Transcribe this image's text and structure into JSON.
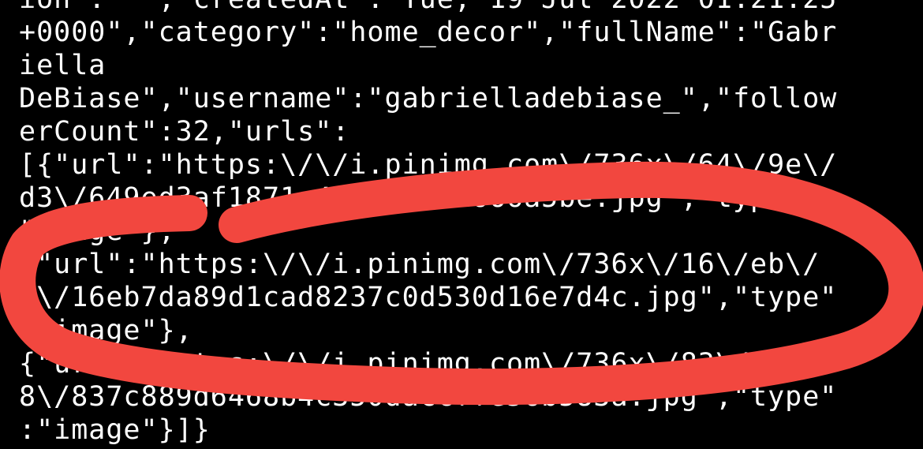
{
  "terminal": {
    "lines": [
      "ion\":\" \",\"createdAt\":\"Tue, 19 Jul 2022 01:21:25",
      "+0000\",\"category\":\"home_decor\",\"fullName\":\"Gabr",
      "iella",
      "DeBiase\",\"username\":\"gabrielladebiase_\",\"follow",
      "erCount\":32,\"urls\":",
      "[{\"url\":\"https:\\/\\/i.pinimg.com\\/736x\\/64\\/9e\\/",
      "d3\\/649ed3af1871c4d746...1666a5be.jpg\",\"type",
      "\"image\"},",
      "{\"url\":\"https:\\/\\/i.pinimg.com\\/736x\\/16\\/eb\\/",
      "d\\/16eb7da89d1cad8237c0d530d16e7d4c.jpg\",\"type\"",
      ":\"image\"},",
      "{\"url\":\"https:\\/\\/i.pinimg.com\\/736x\\/83\\/7c\\/8",
      "8\\/837c889d6468b4c350daccffe56b583a.jpg\",\"type\"",
      ":\"image\"}]}"
    ]
  },
  "annotation": {
    "color": "#f2473f",
    "shape": "hand-drawn loop around the second url entry"
  }
}
